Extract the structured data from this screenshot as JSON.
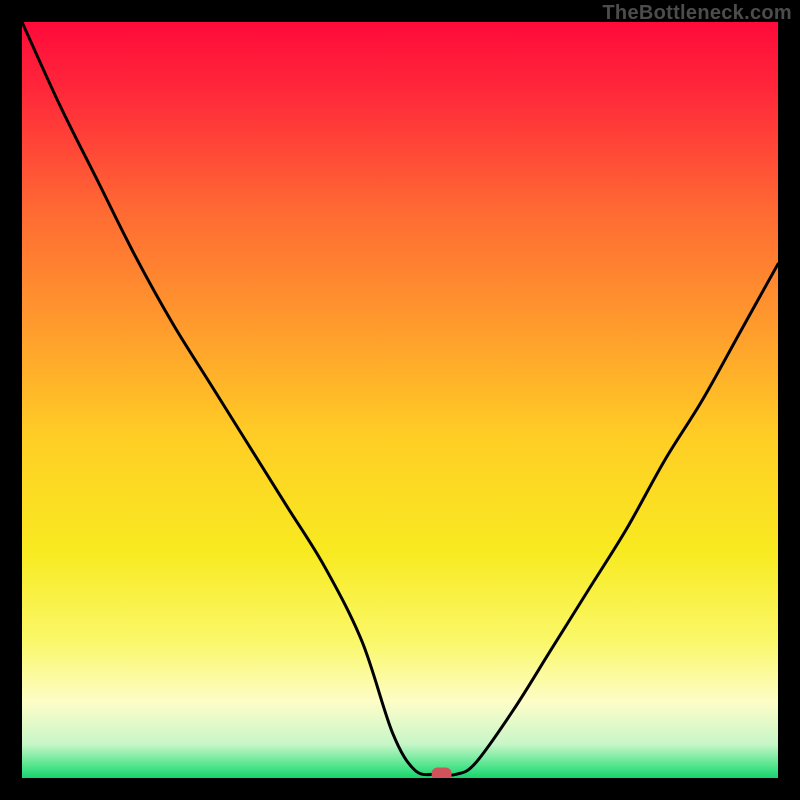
{
  "watermark": "TheBottleneck.com",
  "chart_data": {
    "type": "line",
    "title": "",
    "xlabel": "",
    "ylabel": "",
    "xlim": [
      0,
      100
    ],
    "ylim": [
      0,
      100
    ],
    "series": [
      {
        "name": "curve",
        "x": [
          0,
          5,
          10,
          15,
          20,
          25,
          30,
          35,
          40,
          45,
          49,
          52,
          55,
          57.5,
          60,
          65,
          70,
          75,
          80,
          85,
          90,
          95,
          100
        ],
        "values": [
          100,
          89,
          79,
          69,
          60,
          52,
          44,
          36,
          28,
          18,
          6,
          1,
          0.5,
          0.5,
          2,
          9,
          17,
          25,
          33,
          42,
          50,
          59,
          68
        ]
      }
    ],
    "gradient_stops": [
      {
        "offset": 0,
        "color": "#ff0a3a"
      },
      {
        "offset": 0.1,
        "color": "#ff2b3a"
      },
      {
        "offset": 0.25,
        "color": "#ff6a33"
      },
      {
        "offset": 0.4,
        "color": "#ff9a2d"
      },
      {
        "offset": 0.55,
        "color": "#ffce25"
      },
      {
        "offset": 0.7,
        "color": "#f8ea20"
      },
      {
        "offset": 0.82,
        "color": "#faf86a"
      },
      {
        "offset": 0.9,
        "color": "#fdfdc8"
      },
      {
        "offset": 0.955,
        "color": "#c8f6c8"
      },
      {
        "offset": 0.985,
        "color": "#4ee48a"
      },
      {
        "offset": 1.0,
        "color": "#17d36e"
      }
    ],
    "marker": {
      "x": 55.5,
      "y": 0.6,
      "color": "#d1525a"
    }
  }
}
